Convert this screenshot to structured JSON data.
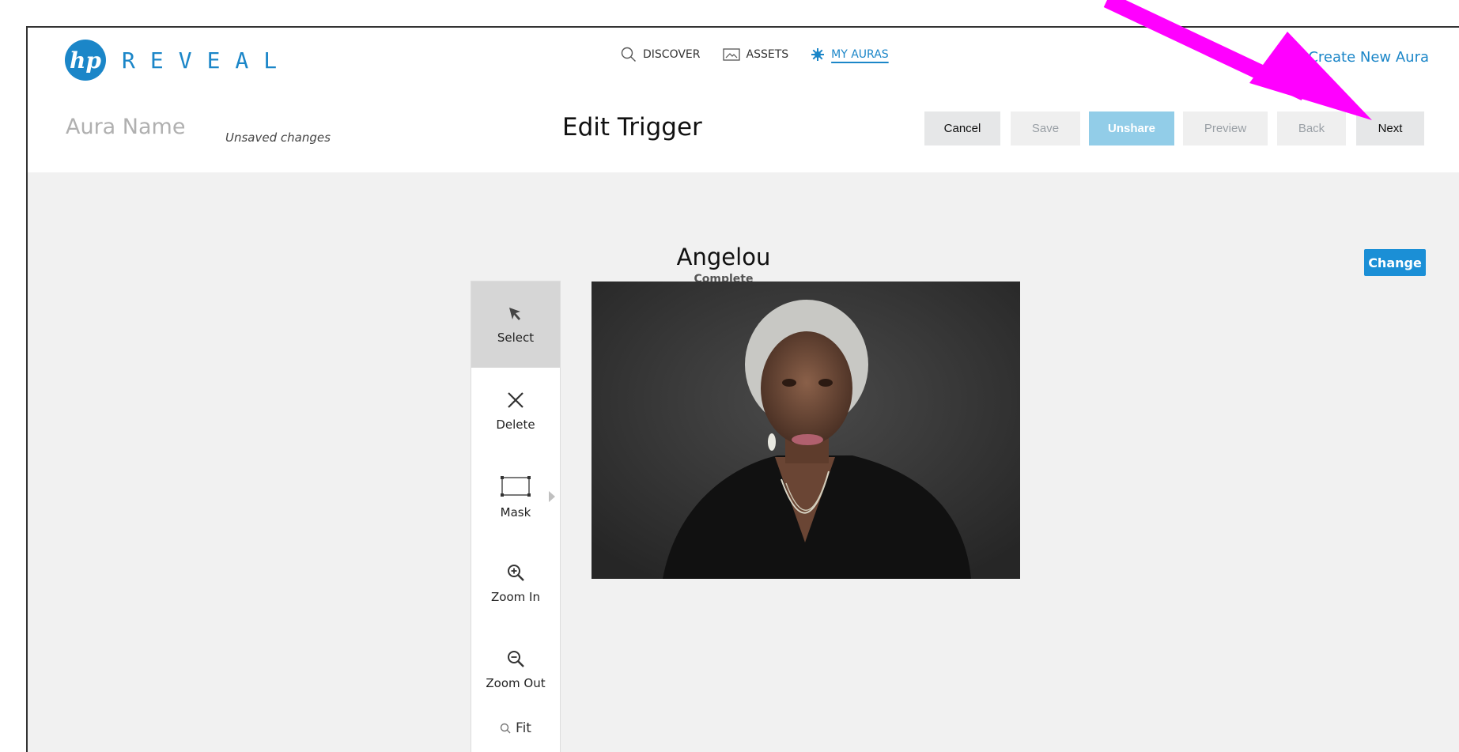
{
  "brand": {
    "logo_mark": "hp",
    "name": "REVEAL"
  },
  "nav": {
    "items": [
      {
        "label": "DISCOVER",
        "icon": "search-icon"
      },
      {
        "label": "ASSETS",
        "icon": "image-icon"
      },
      {
        "label": "MY AURAS",
        "icon": "aura-star-icon",
        "active": true
      }
    ],
    "create_new": "Create New Aura"
  },
  "header": {
    "aura_name": "Aura Name",
    "status": "Unsaved changes",
    "title": "Edit Trigger",
    "buttons": {
      "cancel": "Cancel",
      "save": "Save",
      "unshare": "Unshare",
      "preview": "Preview",
      "back": "Back",
      "next": "Next"
    }
  },
  "trigger": {
    "name": "Angelou",
    "status": "Complete",
    "change_label": "Change"
  },
  "toolbar": {
    "select": "Select",
    "delete": "Delete",
    "mask": "Mask",
    "zoom_in": "Zoom In",
    "zoom_out": "Zoom Out",
    "fit": "Fit"
  },
  "colors": {
    "brand_blue": "#1b86c8",
    "annotation_arrow": "#ff00ff",
    "unshare_bg": "#92cde8",
    "workspace_bg": "#f1f1f1"
  }
}
